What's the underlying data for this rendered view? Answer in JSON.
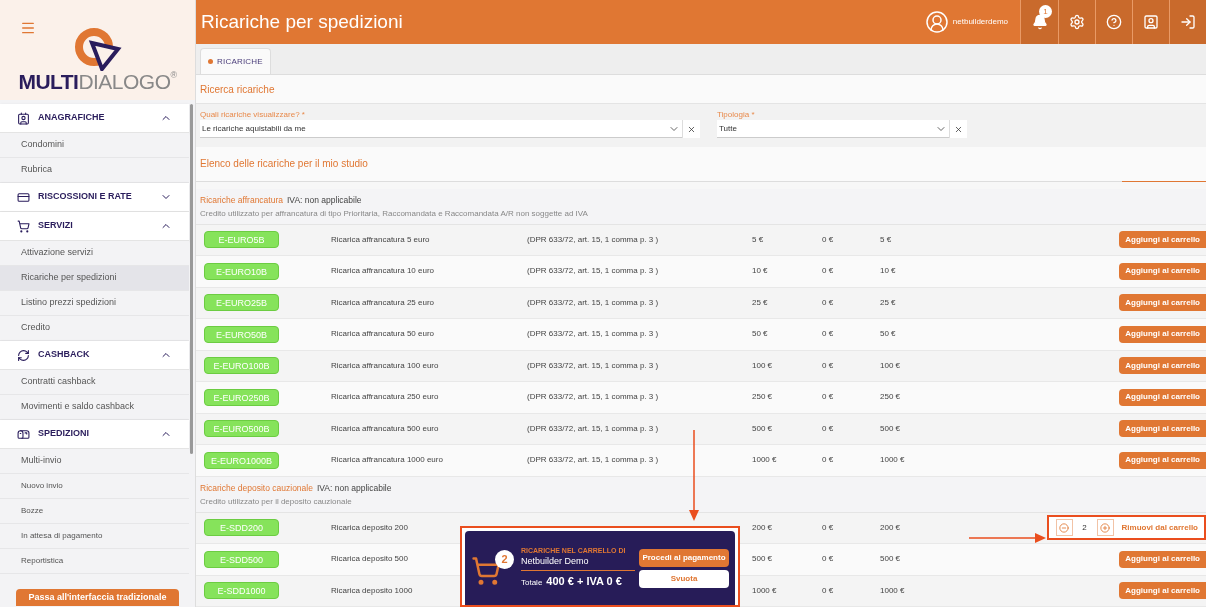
{
  "sidebar": {
    "logo": {
      "bold": "MULTI",
      "light": "DIALOGO",
      "mark": "®"
    },
    "sections": [
      {
        "label": "ANAGRAFICHE",
        "expanded": true,
        "items": [
          {
            "label": "Condomini",
            "selected": false,
            "small": false
          },
          {
            "label": "Rubrica",
            "selected": false,
            "small": false
          }
        ]
      },
      {
        "label": "RISCOSSIONI E RATE",
        "expanded": false
      },
      {
        "label": "SERVIZI",
        "expanded": true,
        "items": [
          {
            "label": "Attivazione servizi",
            "selected": false,
            "small": false
          },
          {
            "label": "Ricariche per spedizioni",
            "selected": true,
            "small": false
          },
          {
            "label": "Listino prezzi spedizioni",
            "selected": false,
            "small": false
          },
          {
            "label": "Credito",
            "selected": false,
            "small": false
          }
        ]
      },
      {
        "label": "CASHBACK",
        "expanded": true,
        "items": [
          {
            "label": "Contratti cashback",
            "selected": false,
            "small": false
          },
          {
            "label": "Movimenti e saldo cashback",
            "selected": false,
            "small": false
          }
        ]
      },
      {
        "label": "SPEDIZIONI",
        "expanded": true,
        "items": [
          {
            "label": "Multi-invio",
            "selected": false,
            "small": false
          },
          {
            "label": "Nuovo invio",
            "selected": false,
            "small": true
          },
          {
            "label": "Bozze",
            "selected": false,
            "small": true
          },
          {
            "label": "In attesa di pagamento",
            "selected": false,
            "small": true
          },
          {
            "label": "Reportistica",
            "selected": false,
            "small": true
          }
        ]
      }
    ],
    "switch_button": "Passa all'interfaccia tradizionale"
  },
  "header": {
    "title": "Ricariche per spedizioni",
    "user": "netbuilderdemo",
    "notifications": "1"
  },
  "tabs": [
    {
      "label": "RICARICHE",
      "selected": true
    }
  ],
  "search": {
    "title": "Ricerca ricariche",
    "filters": [
      {
        "label": "Quali ricariche visualizzare? *",
        "value": "Le ricariche aquistabili da me"
      },
      {
        "label": "Tipologia *",
        "value": "Tutte"
      }
    ]
  },
  "list_title": "Elenco delle ricariche per il mio studio",
  "groups": [
    {
      "title": "Ricariche affrancatura",
      "vat": "IVA: non applicabile",
      "description": "Credito utilizzato per affrancatura di tipo Prioritaria, Raccomandata e Raccomandata A/R non soggette ad IVA",
      "rows": [
        {
          "code": "E-EURO5B",
          "name": "Ricarica affrancatura 5 euro",
          "note": "(DPR 633/72, art. 15, 1 comma p. 3 )",
          "price": "5 €",
          "vat": "0 €",
          "total": "5 €",
          "kind": "add",
          "action": "Aggiungi al carrello"
        },
        {
          "code": "E-EURO10B",
          "name": "Ricarica affrancatura 10 euro",
          "note": "(DPR 633/72, art. 15, 1 comma p. 3 )",
          "price": "10 €",
          "vat": "0 €",
          "total": "10 €",
          "kind": "add",
          "action": "Aggiungi al carrello"
        },
        {
          "code": "E-EURO25B",
          "name": "Ricarica affrancatura 25 euro",
          "note": "(DPR 633/72, art. 15, 1 comma p. 3 )",
          "price": "25 €",
          "vat": "0 €",
          "total": "25 €",
          "kind": "add",
          "action": "Aggiungi al carrello"
        },
        {
          "code": "E-EURO50B",
          "name": "Ricarica affrancatura 50 euro",
          "note": "(DPR 633/72, art. 15, 1 comma p. 3 )",
          "price": "50 €",
          "vat": "0 €",
          "total": "50 €",
          "kind": "add",
          "action": "Aggiungi al carrello"
        },
        {
          "code": "E-EURO100B",
          "name": "Ricarica affrancatura 100 euro",
          "note": "(DPR 633/72, art. 15, 1 comma p. 3 )",
          "price": "100 €",
          "vat": "0 €",
          "total": "100 €",
          "kind": "add",
          "action": "Aggiungi al carrello"
        },
        {
          "code": "E-EURO250B",
          "name": "Ricarica affrancatura 250 euro",
          "note": "(DPR 633/72, art. 15, 1 comma p. 3 )",
          "price": "250 €",
          "vat": "0 €",
          "total": "250 €",
          "kind": "add",
          "action": "Aggiungi al carrello"
        },
        {
          "code": "E-EURO500B",
          "name": "Ricarica affrancatura 500 euro",
          "note": "(DPR 633/72, art. 15, 1 comma p. 3 )",
          "price": "500 €",
          "vat": "0 €",
          "total": "500 €",
          "kind": "add",
          "action": "Aggiungi al carrello"
        },
        {
          "code": "E-EURO1000B",
          "name": "Ricarica affrancatura 1000 euro",
          "note": "(DPR 633/72, art. 15, 1 comma p. 3 )",
          "price": "1000 €",
          "vat": "0 €",
          "total": "1000 €",
          "kind": "add",
          "action": "Aggiungi al carrello"
        }
      ]
    },
    {
      "title": "Ricariche deposito cauzionale",
      "vat": "IVA: non applicabile",
      "description": "Credito utilizzato per il deposito cauzionale",
      "rows": [
        {
          "code": "E-SDD200",
          "name": "Ricarica deposito 200",
          "price": "200 €",
          "vat": "0 €",
          "total": "200 €",
          "kind": "in_cart",
          "quantity": "2",
          "action": "Rimuovi dal carrello"
        },
        {
          "code": "E-SDD500",
          "name": "Ricarica deposito 500",
          "price": "500 €",
          "vat": "0 €",
          "total": "500 €",
          "kind": "add",
          "action": "Aggiungi al carrello"
        },
        {
          "code": "E-SDD1000",
          "name": "Ricarica deposito 1000",
          "price": "1000 €",
          "vat": "0 €",
          "total": "1000 €",
          "kind": "add",
          "action": "Aggiungi al carrello"
        }
      ]
    }
  ],
  "cart": {
    "count": "2",
    "caption": "RICARICHE NEL CARRELLO DI",
    "owner": "Netbuilder Demo",
    "total_label": "Totale",
    "total": "400 € + IVA 0 €",
    "pay": "Procedi al pagamento",
    "empty": "Svuota"
  }
}
